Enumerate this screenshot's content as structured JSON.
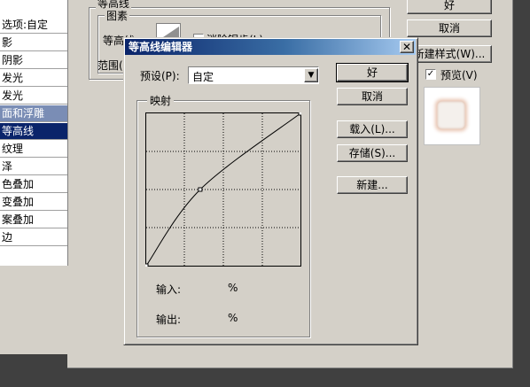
{
  "background": {
    "left_list": {
      "header": "选项:自定",
      "items": [
        "影",
        "阴影",
        "发光",
        "发光",
        "面和浮雕",
        "等高线",
        "纹理",
        "泽",
        "色叠加",
        "变叠加",
        "案叠加",
        "边"
      ],
      "selected_secondary": 4,
      "selected_primary": 5
    },
    "group_title": "等高线",
    "sub_group": "图素",
    "contour_label": "等高线",
    "antialias_label": "消除锯齿(L)",
    "range_label": "范围(",
    "buttons": {
      "ok": "好",
      "cancel": "取消",
      "new_style": "新建样式(W)..."
    },
    "preview_label": "预览(V)",
    "preview_checked": true
  },
  "dialog": {
    "title": "等高线编辑器",
    "close_glyph": "✕",
    "preset_label": "预设(P):",
    "preset_value": "自定",
    "mapping_label": "映射",
    "input_label": "输入:",
    "input_value": "%",
    "output_label": "输出:",
    "output_value": "%",
    "buttons": {
      "ok": "好",
      "cancel": "取消",
      "load": "载入(L)...",
      "save": "存储(S)...",
      "new": "新建..."
    },
    "curve_points": [
      [
        0,
        0
      ],
      [
        0.35,
        0.5
      ],
      [
        1,
        1
      ]
    ]
  },
  "colors": {
    "selection": "#0a246a",
    "selection_secondary": "#7a8db5",
    "face": "#d4d0c8"
  }
}
